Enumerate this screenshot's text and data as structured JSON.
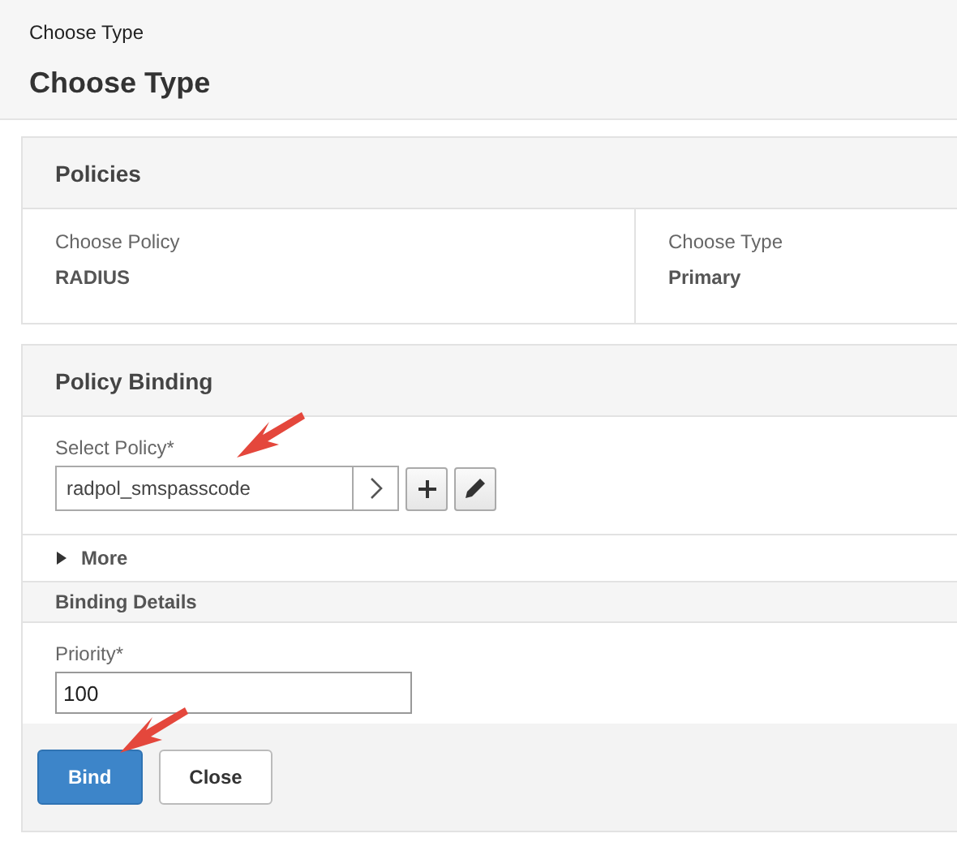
{
  "breadcrumb": "Choose Type",
  "title": "Choose Type",
  "policies": {
    "heading": "Policies",
    "fields": [
      {
        "label": "Choose Policy",
        "value": "RADIUS"
      },
      {
        "label": "Choose Type",
        "value": "Primary"
      }
    ]
  },
  "policy_binding": {
    "heading": "Policy Binding",
    "select_policy": {
      "label": "Select Policy*",
      "value": "radpol_smspasscode"
    },
    "more": {
      "label": "More",
      "expanded": false
    },
    "binding_details": {
      "heading": "Binding Details",
      "priority": {
        "label": "Priority*",
        "value": "100"
      }
    }
  },
  "buttons": [
    {
      "label": "Bind",
      "kind": "primary"
    },
    {
      "label": "Close",
      "kind": "secondary"
    }
  ]
}
